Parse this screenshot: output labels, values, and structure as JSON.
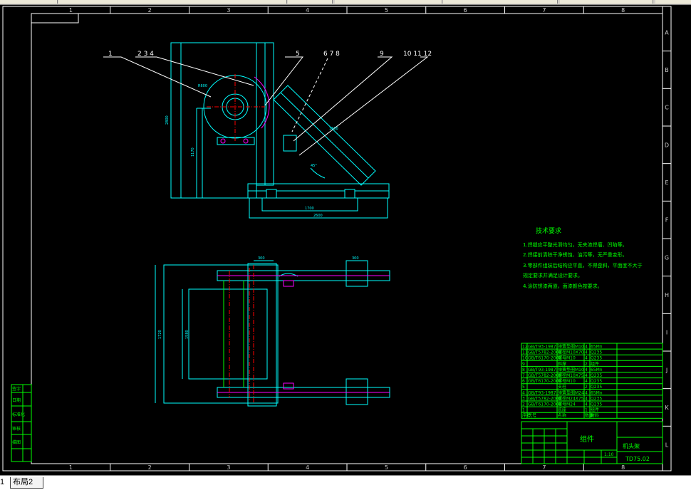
{
  "drawing": {
    "grid_columns": [
      "1",
      "2",
      "3",
      "4",
      "5",
      "6",
      "7",
      "8"
    ],
    "grid_rows": [
      "A",
      "B",
      "C",
      "D",
      "E",
      "F",
      "G",
      "H",
      "I",
      "J",
      "K",
      "L"
    ],
    "leaders": [
      "1",
      "2 3 4",
      "5",
      "6 7 8",
      "9",
      "10 11 12"
    ],
    "dimensions": {
      "r": "R600",
      "h_total": "2800",
      "h_mid": "1170",
      "diag": "1600",
      "angle": "45°",
      "base_inner": "1700",
      "base_outer": "2600",
      "top_a": "300",
      "top_b": "300",
      "plan_w": "1720",
      "plan_h": "1580"
    },
    "notes": {
      "title": "技术要求",
      "items": [
        "1.焊缝应平整光滑均匀，无夹渣焊瘤、凹陷等。",
        "2.焊接前清除干净锈蚀、油污等，无严重变形。",
        "3.零部件组装后结构应平直，不得歪斜，平面度不大于",
        "   规定要求并满足设计要求。",
        "4.涂防锈漆两道，面漆颜色按要求。"
      ]
    },
    "bom_rows": [
      {
        "no": "12",
        "code": "GB/T93-1987",
        "name": "弹簧垫圈M10",
        "qty": "4",
        "mat": "65Mn"
      },
      {
        "no": "11",
        "code": "GB/T5782-2000",
        "name": "螺栓M10X70",
        "qty": "4",
        "mat": "Q235"
      },
      {
        "no": "10",
        "code": "GB/T6170-2000",
        "name": "螺母M10",
        "qty": "4",
        "mat": "Q235"
      },
      {
        "no": "9",
        "code": "",
        "name": "斜撑",
        "qty": "2",
        "mat": "组件"
      },
      {
        "no": "8",
        "code": "GB/T93-1987",
        "name": "弹簧垫圈M10",
        "qty": "4",
        "mat": "65Mn"
      },
      {
        "no": "7",
        "code": "GB/T5782-2000",
        "name": "螺栓M10X75",
        "qty": "4",
        "mat": "Q235"
      },
      {
        "no": "6",
        "code": "GB/T6170-2000",
        "name": "螺母M10",
        "qty": "4",
        "mat": "Q235"
      },
      {
        "no": "5",
        "code": "",
        "name": "支柱",
        "qty": "2",
        "mat": "Q235"
      },
      {
        "no": "4",
        "code": "GB/T93-1987",
        "name": "弹簧垫圈M24",
        "qty": "4",
        "mat": "65Mn"
      },
      {
        "no": "3",
        "code": "GB/T5782-2000",
        "name": "螺栓M24X75",
        "qty": "4",
        "mat": "Q235"
      },
      {
        "no": "2",
        "code": "GB/T6170-2000",
        "name": "螺母M24",
        "qty": "4",
        "mat": "Q235"
      },
      {
        "no": "1",
        "code": "",
        "name": "底座",
        "qty": "1",
        "mat": "组件"
      }
    ],
    "bom_header": [
      "序号",
      "代号",
      "名称",
      "数量",
      "材料"
    ],
    "title_block": {
      "part_name": "组件",
      "drawing_title": "机头架",
      "drawing_no": "TD75.02",
      "scale": "1:10",
      "left_strip": [
        "签字",
        "日期",
        "标准化",
        "审核",
        "描图"
      ]
    }
  },
  "tabs": {
    "first": "1",
    "second": "布局2"
  },
  "colors": {
    "background": "#000000",
    "frame": "#ffffff",
    "geometry": "#00ffff",
    "text": "#00ff00",
    "centerline": "#ff0000",
    "highlight": "#ff00ff"
  }
}
